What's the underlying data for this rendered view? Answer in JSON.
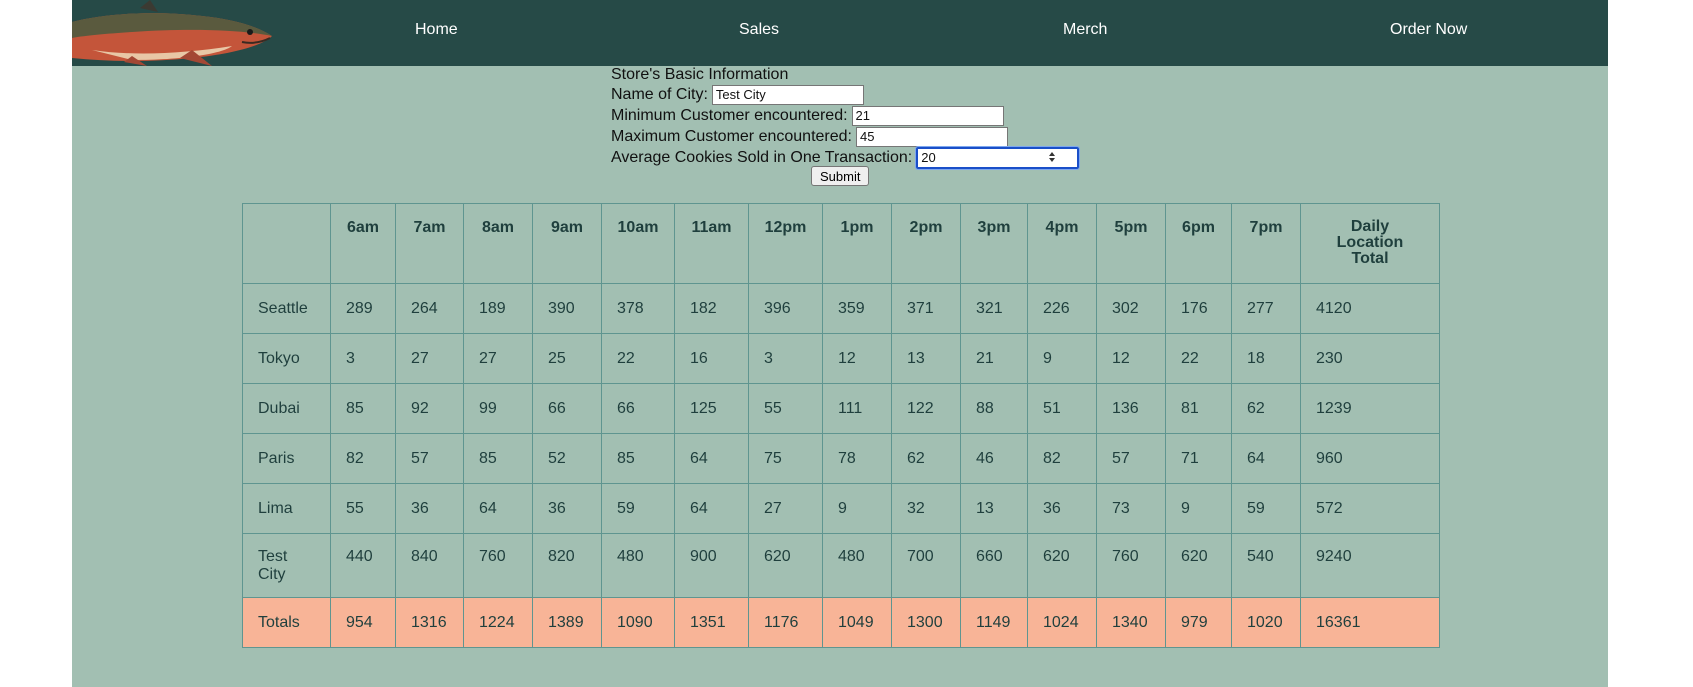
{
  "nav": {
    "logo": "salmon-icon",
    "links": [
      "Home",
      "Sales",
      "Merch",
      "Order Now"
    ]
  },
  "form": {
    "heading": "Store's Basic Information",
    "city_label": "Name of City:",
    "city_value": "Test City",
    "min_label": "Minimum Customer encountered:",
    "min_value": "21",
    "max_label": "Maximum Customer encountered:",
    "max_value": "45",
    "avg_label": "Average Cookies Sold in One Transaction:",
    "avg_value": "20",
    "submit_label": "Submit"
  },
  "table": {
    "headers": [
      "",
      "6am",
      "7am",
      "8am",
      "9am",
      "10am",
      "11am",
      "12pm",
      "1pm",
      "2pm",
      "3pm",
      "4pm",
      "5pm",
      "6pm",
      "7pm",
      "Daily Location Total"
    ],
    "rows": [
      [
        "Seattle",
        "289",
        "264",
        "189",
        "390",
        "378",
        "182",
        "396",
        "359",
        "371",
        "321",
        "226",
        "302",
        "176",
        "277",
        "4120"
      ],
      [
        "Tokyo",
        "3",
        "27",
        "27",
        "25",
        "22",
        "16",
        "3",
        "12",
        "13",
        "21",
        "9",
        "12",
        "22",
        "18",
        "230"
      ],
      [
        "Dubai",
        "85",
        "92",
        "99",
        "66",
        "66",
        "125",
        "55",
        "111",
        "122",
        "88",
        "51",
        "136",
        "81",
        "62",
        "1239"
      ],
      [
        "Paris",
        "82",
        "57",
        "85",
        "52",
        "85",
        "64",
        "75",
        "78",
        "62",
        "46",
        "82",
        "57",
        "71",
        "64",
        "960"
      ],
      [
        "Lima",
        "55",
        "36",
        "64",
        "36",
        "59",
        "64",
        "27",
        "9",
        "32",
        "13",
        "36",
        "73",
        "9",
        "59",
        "572"
      ],
      [
        "Test City",
        "440",
        "840",
        "760",
        "820",
        "480",
        "900",
        "620",
        "480",
        "700",
        "660",
        "620",
        "760",
        "620",
        "540",
        "9240"
      ]
    ],
    "totals": [
      "Totals",
      "954",
      "1316",
      "1224",
      "1389",
      "1090",
      "1351",
      "1176",
      "1049",
      "1300",
      "1149",
      "1024",
      "1340",
      "979",
      "1020",
      "16361"
    ]
  },
  "colors": {
    "nav_bg": "#264a47",
    "page_bg": "#a2bfb2",
    "totals_bg": "#f8b497",
    "cell_text": "#1f3f3d"
  }
}
